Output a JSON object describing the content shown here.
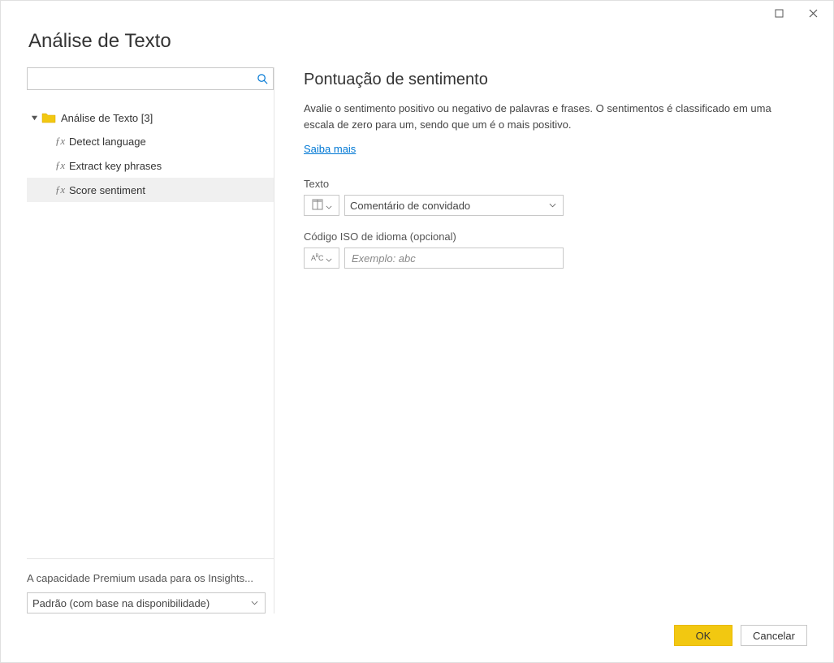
{
  "dialog": {
    "title": "Análise de Texto"
  },
  "search": {
    "value": ""
  },
  "tree": {
    "root_label": "Análise de Texto [3]",
    "items": [
      {
        "label": "Detect language"
      },
      {
        "label": "Extract key phrases"
      },
      {
        "label": "Score sentiment"
      }
    ],
    "selected_index": 2
  },
  "capacity": {
    "label": "A capacidade Premium usada para os Insights...",
    "selected": "Padrão (com base na disponibilidade)"
  },
  "detail": {
    "title": "Pontuação de sentimento",
    "description": "Avalie o sentimento positivo ou negativo de palavras e frases. O sentimentos é classificado em uma escala de zero para um, sendo que um é o mais positivo.",
    "learn_more": "Saiba mais"
  },
  "fields": {
    "text": {
      "label": "Texto",
      "selected_column": "Comentário de convidado"
    },
    "iso": {
      "label": "Código ISO de idioma (opcional)",
      "placeholder": "Exemplo: abc",
      "value": ""
    }
  },
  "buttons": {
    "ok": "OK",
    "cancel": "Cancelar"
  },
  "icons": {
    "column": "column-icon",
    "abc": "abc-icon"
  }
}
